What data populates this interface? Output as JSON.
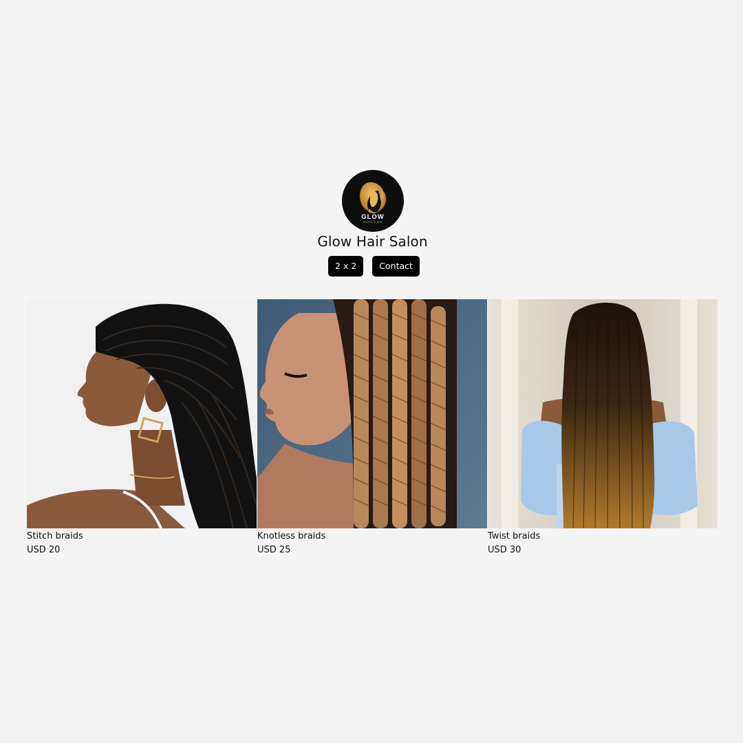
{
  "profile": {
    "name": "Glow Hair Salon",
    "logo_text": "GLOW",
    "logo_subtext": "SALON & SPA",
    "logo_icon": "woman-silhouette-icon"
  },
  "buttons": {
    "grid_label": "2 x 2",
    "contact_label": "Contact"
  },
  "colors": {
    "background": "#f4f4f4",
    "button_bg": "#000000",
    "button_text": "#ffffff",
    "logo_gold": "#d4a03a"
  },
  "products": [
    {
      "title": "Stitch braids",
      "price": "USD 20"
    },
    {
      "title": "Knotless braids",
      "price": "USD 25"
    },
    {
      "title": "Twist braids",
      "price": "USD 30"
    }
  ]
}
